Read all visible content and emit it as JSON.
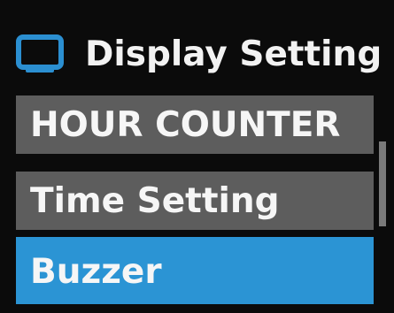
{
  "header": {
    "title": "Display Setting",
    "icon": "monitor-icon"
  },
  "menu": {
    "items": [
      {
        "label": "HOUR COUNTER",
        "selected": false
      },
      {
        "label": "Time Setting",
        "selected": false
      },
      {
        "label": "Buzzer",
        "selected": true
      }
    ]
  },
  "colors": {
    "background": "#0b0b0b",
    "item_bg": "#5d5d5d",
    "selected_bg": "#2b94d4",
    "icon": "#2b8fd1",
    "scrollbar": "#7a7a7a",
    "text": "#f4f4f4"
  }
}
